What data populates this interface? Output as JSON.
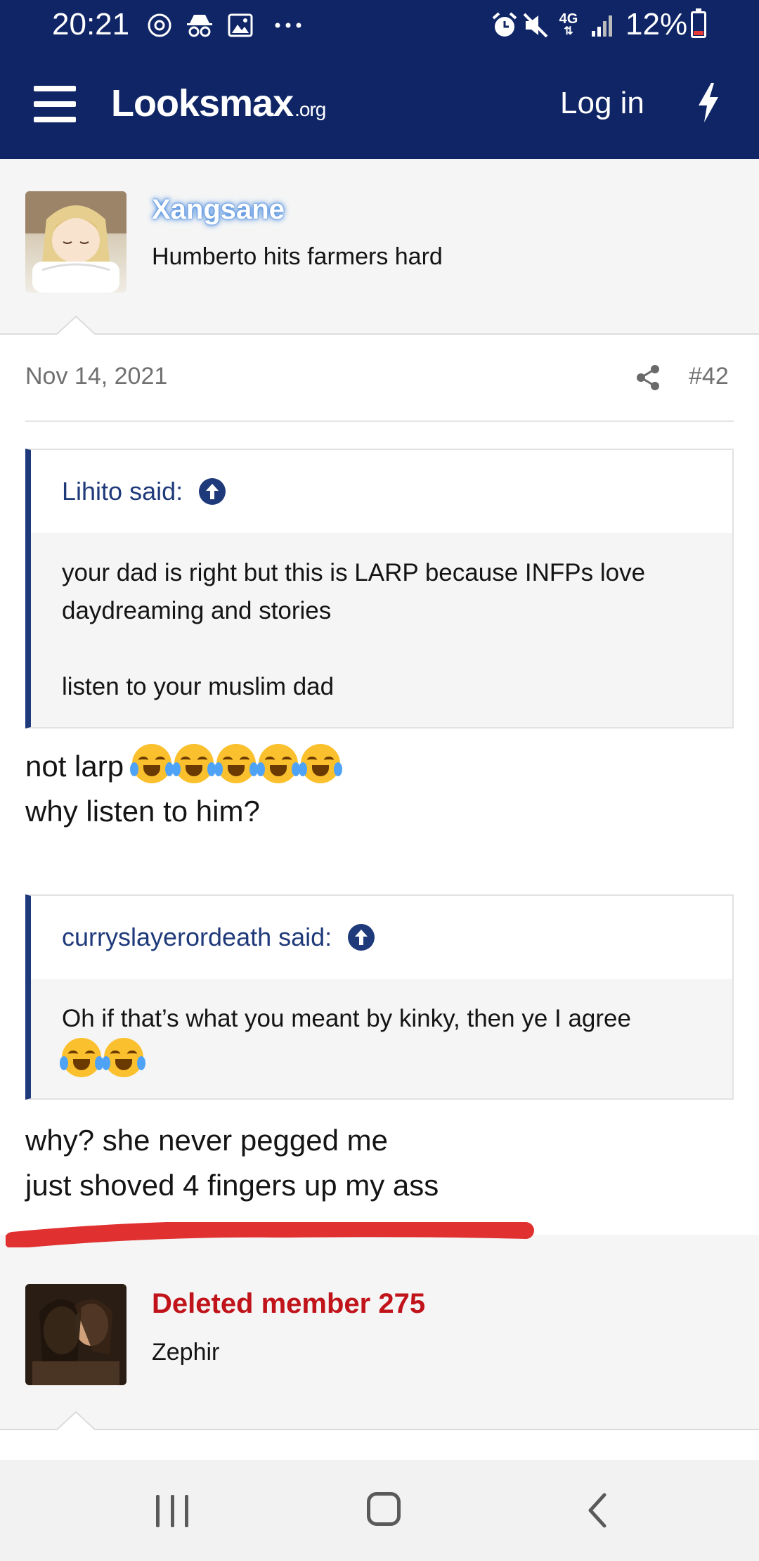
{
  "status_bar": {
    "time": "20:21",
    "network": "4G",
    "battery": "12%",
    "left_icons": [
      "sync-icon",
      "incognito-icon",
      "image-icon",
      "more-dots-icon"
    ],
    "right_icons": [
      "alarm-icon",
      "mute-icon",
      "signal-icon",
      "battery-icon"
    ]
  },
  "header": {
    "logo_main": "Looksmax",
    "logo_suffix": ".org",
    "login_label": "Log in",
    "brand_color": "#0f2566"
  },
  "post": {
    "author": "Xangsane",
    "author_title": "Humberto hits farmers hard",
    "date": "Nov 14, 2021",
    "number": "#42",
    "quotes": [
      {
        "author": "Lihito said:",
        "lines": [
          "your dad is right but this is LARP because INFPs love daydreaming and stories",
          "listen to your muslim dad"
        ]
      },
      {
        "author": "curryslayerordeath said:",
        "lines": [
          "Oh if that’s what you meant by kinky, then ye I agree"
        ]
      }
    ],
    "reply1": [
      "not larp",
      "why listen to him?"
    ],
    "reply2": [
      "why? she never pegged me",
      "just shoved 4 fingers up my ass"
    ]
  },
  "next_post": {
    "author": "Deleted member 275",
    "author_title": "Zephir"
  },
  "colors": {
    "quote_border": "#1f3a7a",
    "deleted_member": "#c0131a",
    "annotation_red": "#e03030"
  }
}
